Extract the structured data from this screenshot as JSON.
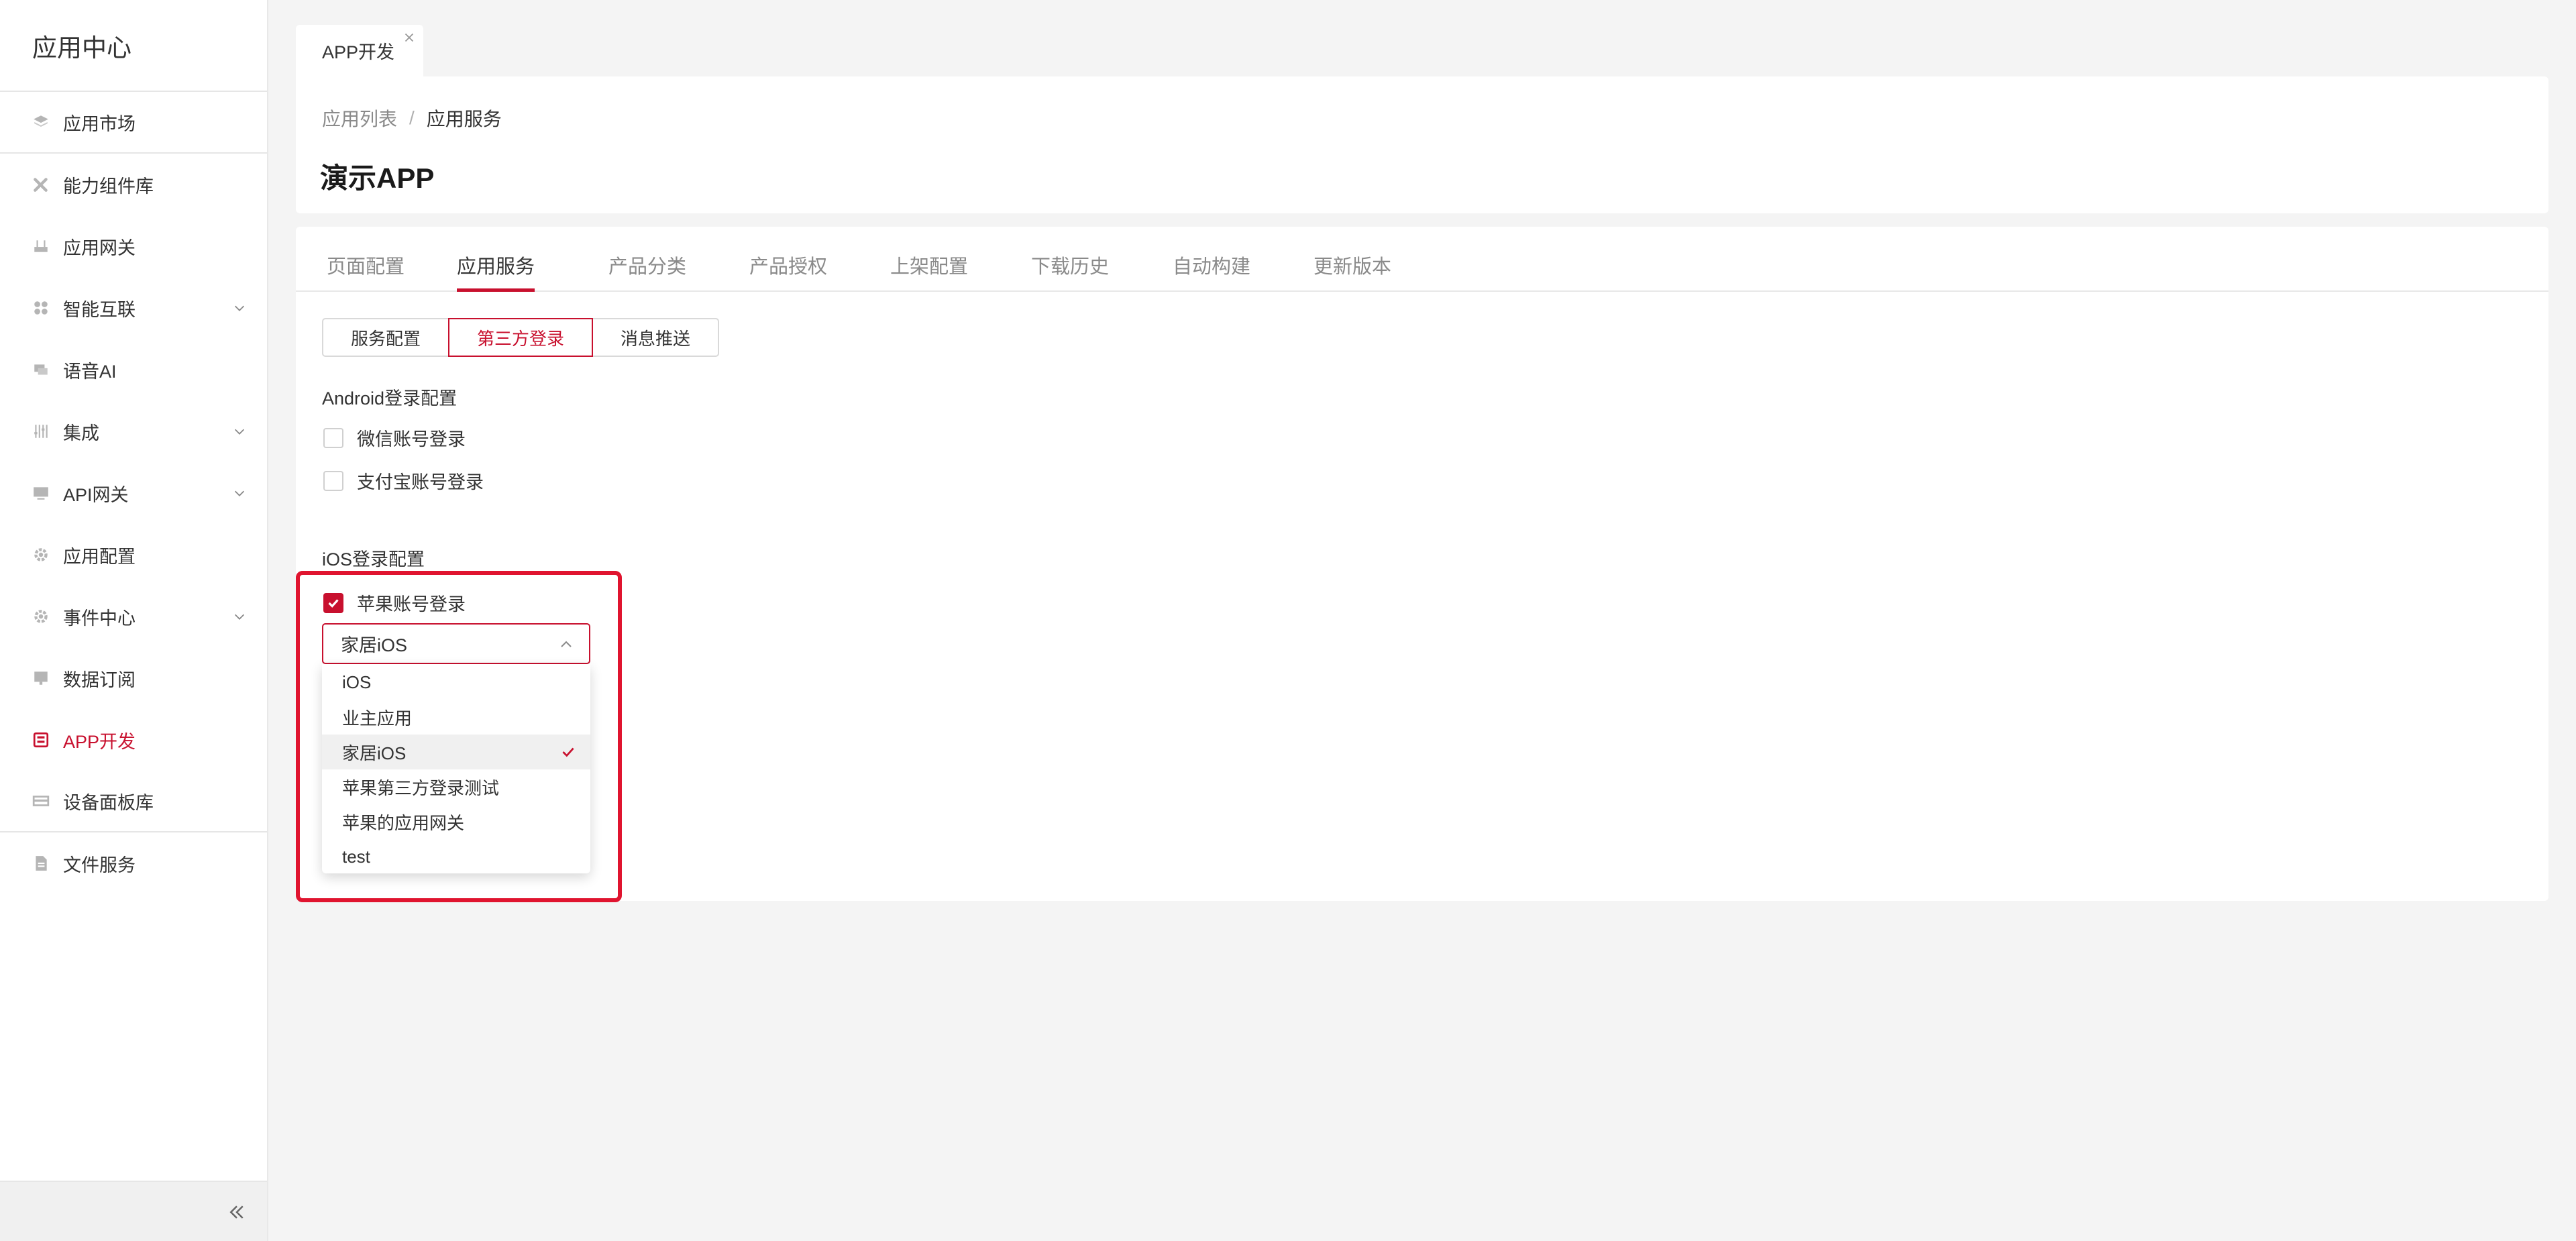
{
  "sidebar": {
    "title": "应用中心",
    "items": [
      {
        "label": "应用市场",
        "icon": "layers-icon"
      },
      {
        "label": "能力组件库",
        "icon": "tools-icon"
      },
      {
        "label": "应用网关",
        "icon": "router-icon"
      },
      {
        "label": "智能互联",
        "icon": "grid-icon"
      },
      {
        "label": "语音AI",
        "icon": "chat-icon"
      },
      {
        "label": "集成",
        "icon": "sliders-icon"
      },
      {
        "label": "API网关",
        "icon": "monitor-icon"
      },
      {
        "label": "应用配置",
        "icon": "gear-icon"
      },
      {
        "label": "事件中心",
        "icon": "gear-icon"
      },
      {
        "label": "数据订阅",
        "icon": "display-icon"
      },
      {
        "label": "APP开发",
        "icon": "app-icon"
      },
      {
        "label": "设备面板库",
        "icon": "panel-icon"
      },
      {
        "label": "文件服务",
        "icon": "file-icon"
      }
    ],
    "collapse_icon": "double-chevron-left-icon"
  },
  "page_tab": {
    "label": "APP开发"
  },
  "breadcrumb": {
    "prev": "应用列表",
    "separator": "/",
    "current": "应用服务"
  },
  "page_title": "演示APP",
  "tabs": [
    "页面配置",
    "应用服务",
    "产品分类",
    "产品授权",
    "上架配置",
    "下载历史",
    "自动构建",
    "更新版本"
  ],
  "active_tab": "应用服务",
  "segments": [
    "服务配置",
    "第三方登录",
    "消息推送"
  ],
  "active_segment": "第三方登录",
  "android": {
    "label": "Android登录配置",
    "options": [
      {
        "label": "微信账号登录",
        "checked": false
      },
      {
        "label": "支付宝账号登录",
        "checked": false
      }
    ]
  },
  "ios": {
    "label": "iOS登录配置",
    "apple_login": {
      "label": "苹果账号登录",
      "checked": true
    },
    "select": {
      "value": "家居iOS",
      "options": [
        "iOS",
        "业主应用",
        "家居iOS",
        "苹果第三方登录测试",
        "苹果的应用网关",
        "test"
      ]
    }
  },
  "colors": {
    "accent": "#c8102e",
    "highlight": "#e0142f",
    "background": "#f4f4f4"
  }
}
